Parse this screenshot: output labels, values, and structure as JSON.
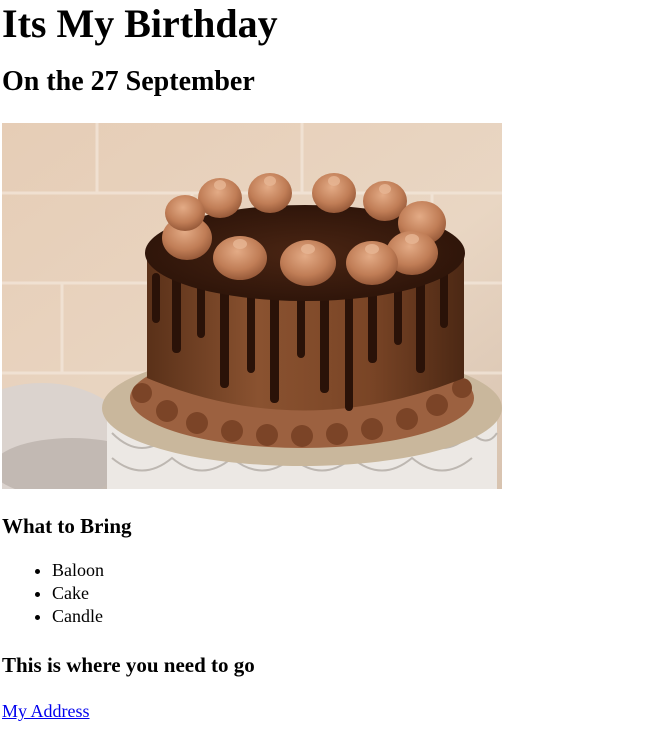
{
  "heading": "Its My Birthday",
  "subheading": "On the 27 September",
  "image": {
    "alt": "chocolate-cake-photo"
  },
  "bring": {
    "title": "What to Bring",
    "items": [
      "Baloon",
      "Cake",
      "Candle"
    ]
  },
  "location": {
    "title": "This is where you need to go",
    "link_text": "My Address"
  },
  "colors": {
    "link": "#0000ee",
    "text": "#000000",
    "background": "#ffffff"
  }
}
